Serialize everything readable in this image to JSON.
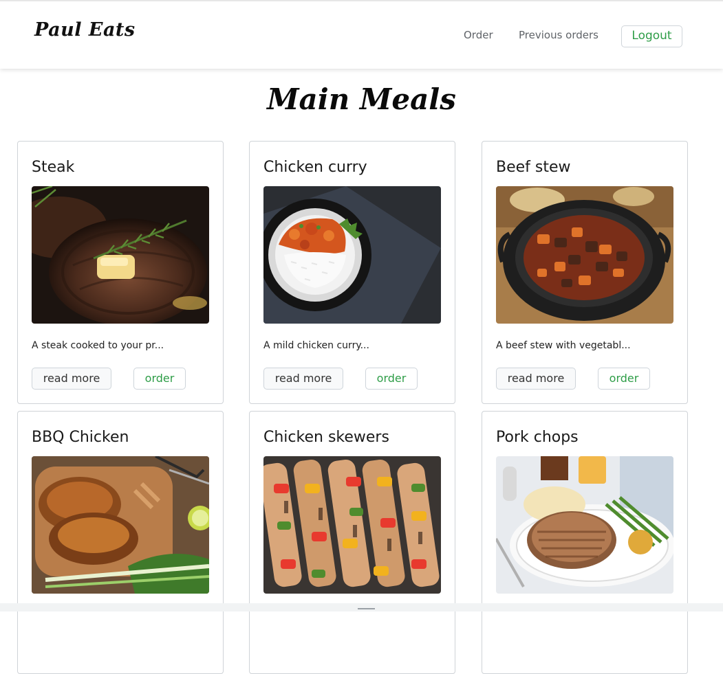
{
  "navbar": {
    "brand": "Paul Eats",
    "links": [
      {
        "label": "Order"
      },
      {
        "label": "Previous orders"
      }
    ],
    "logout_label": "Logout"
  },
  "page": {
    "title": "Main Meals"
  },
  "meals": [
    {
      "name": "Steak",
      "description": "A steak cooked to your pr...",
      "read_more_label": "read more",
      "order_label": "order",
      "image": "steak-photo"
    },
    {
      "name": "Chicken curry",
      "description": "A mild chicken curry...",
      "read_more_label": "read more",
      "order_label": "order",
      "image": "chicken-curry-photo"
    },
    {
      "name": "Beef stew",
      "description": "A beef stew with vegetabl...",
      "read_more_label": "read more",
      "order_label": "order",
      "image": "beef-stew-photo"
    },
    {
      "name": "BBQ Chicken",
      "image": "bbq-chicken-photo"
    },
    {
      "name": "Chicken skewers",
      "image": "chicken-skewers-photo"
    },
    {
      "name": "Pork chops",
      "image": "pork-chops-photo"
    }
  ],
  "colors": {
    "accent_green": "#2e9d47",
    "border": "#cfd3d7",
    "text": "#1a1a1a"
  }
}
